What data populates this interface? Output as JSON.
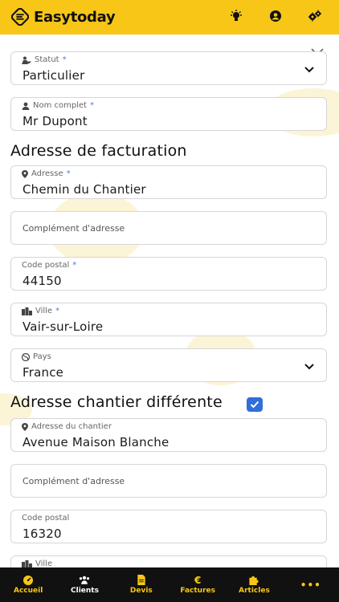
{
  "app": {
    "name": "Easytoday"
  },
  "colors": {
    "brand": "#f7c617",
    "accent": "#2f6fd9",
    "nav_bg": "#111111"
  },
  "header_icons": [
    "lightbulb-icon",
    "user-circle-icon",
    "gears-icon"
  ],
  "form": {
    "statut": {
      "label": "Statut",
      "required": "*",
      "value": "Particulier"
    },
    "nom": {
      "label": "Nom complet",
      "required": "*",
      "value": "Mr Dupont"
    },
    "facturation_title": "Adresse de facturation",
    "adresse": {
      "label": "Adresse",
      "required": "*",
      "value": "Chemin du Chantier"
    },
    "complement": {
      "placeholder": "Complément d'adresse"
    },
    "code_postal": {
      "label": "Code postal",
      "required": "*",
      "value": "44150"
    },
    "ville": {
      "label": "Ville",
      "required": "*",
      "value": "Vair-sur-Loire"
    },
    "pays": {
      "label": "Pays",
      "value": "France"
    },
    "chantier_title": "Adresse chantier différente",
    "chantier_checked": true,
    "chantier_adresse": {
      "label": "Adresse du chantier",
      "value": "Avenue Maison Blanche"
    },
    "chantier_complement": {
      "placeholder": "Complément d'adresse"
    },
    "chantier_code_postal": {
      "label": "Code postal",
      "value": "16320"
    },
    "chantier_ville": {
      "label": "Ville"
    }
  },
  "nav": [
    {
      "label": "Accueil",
      "icon": "gauge-icon"
    },
    {
      "label": "Clients",
      "icon": "users-icon"
    },
    {
      "label": "Devis",
      "icon": "file-icon"
    },
    {
      "label": "Factures",
      "icon": "euro-icon"
    },
    {
      "label": "Articles",
      "icon": "puzzle-icon"
    },
    {
      "label": "•••",
      "icon": "more-icon"
    }
  ]
}
